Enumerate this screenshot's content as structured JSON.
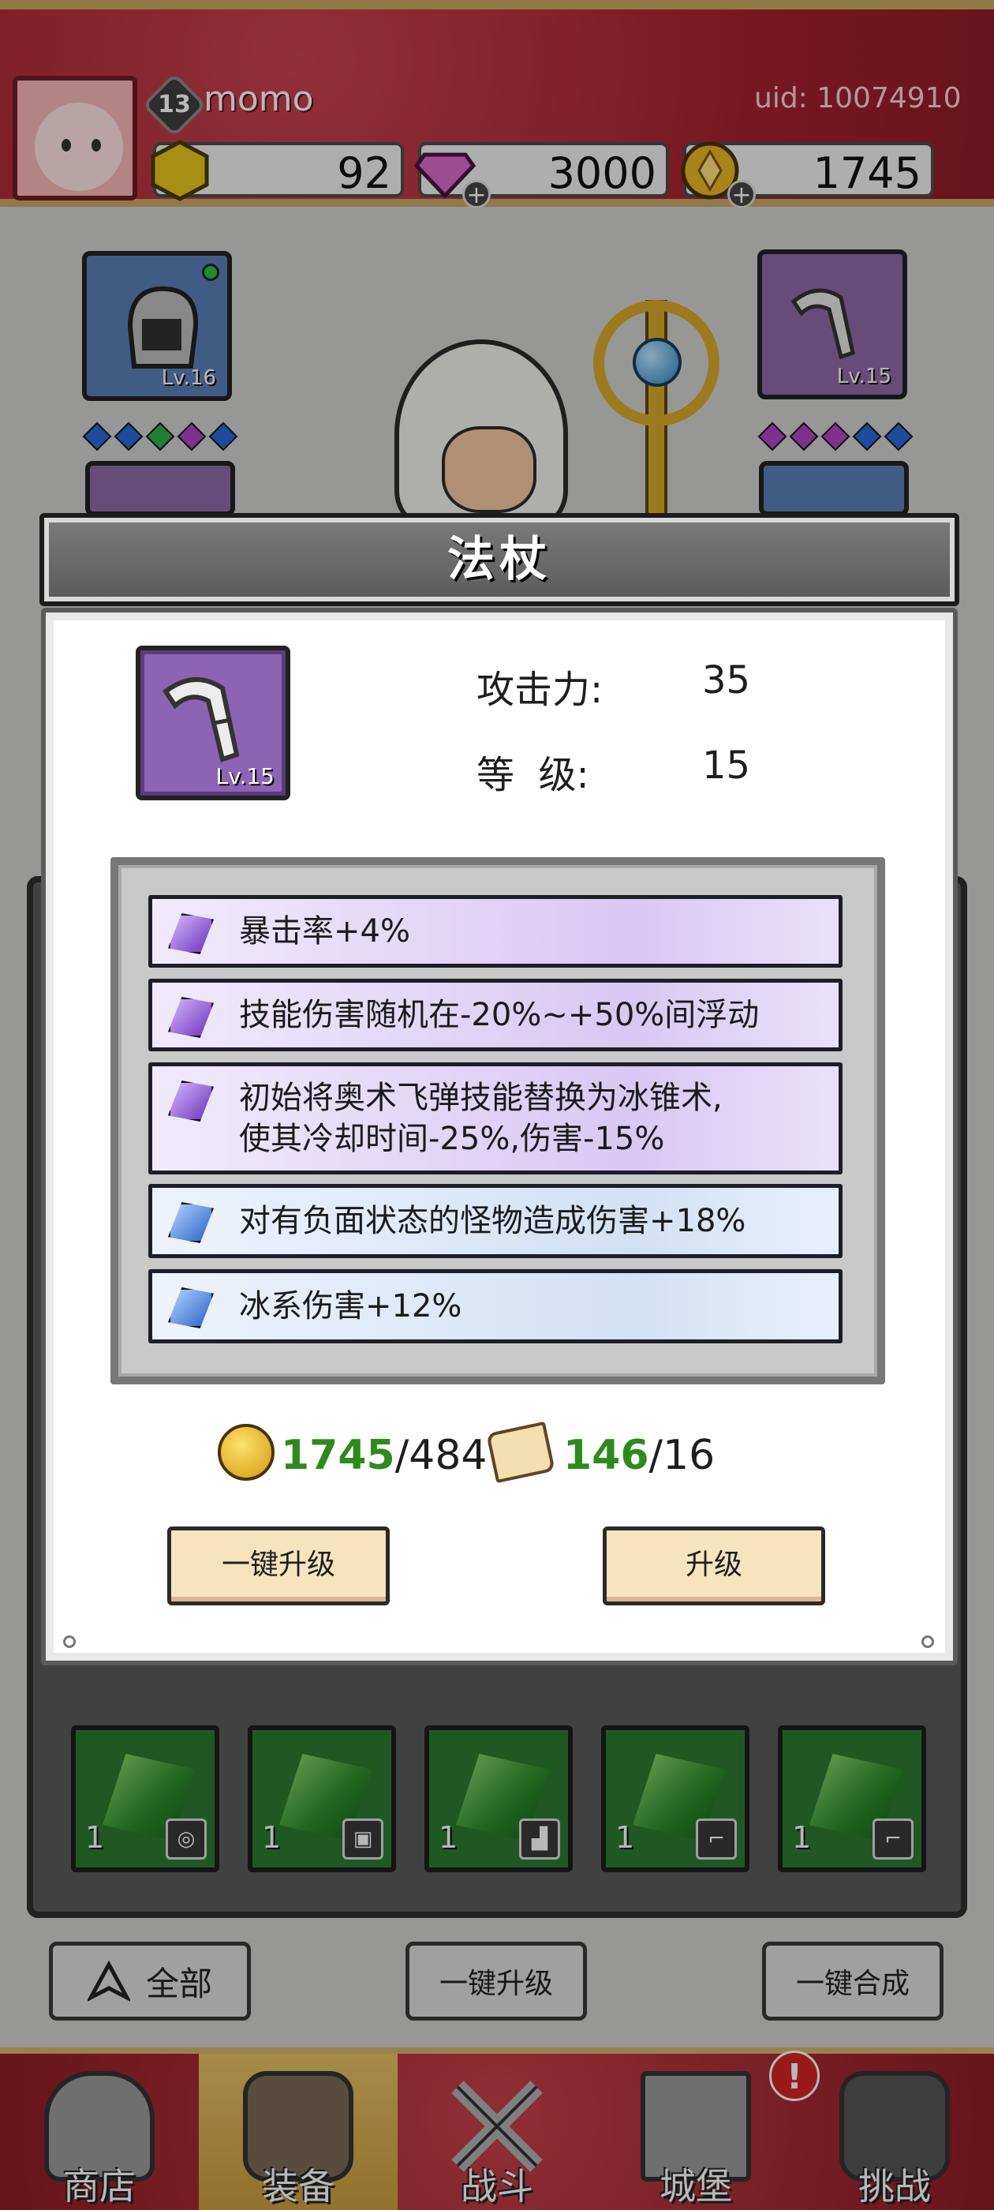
{
  "header": {
    "level": "13",
    "username": "momo",
    "uid": "uid: 10074910",
    "resources": [
      {
        "name": "gold-gem",
        "value": "92"
      },
      {
        "name": "diamond",
        "value": "3000"
      },
      {
        "name": "coin",
        "value": "1745"
      }
    ]
  },
  "equipment": {
    "left_slot": {
      "level_label": "Lv.16"
    },
    "right_slot": {
      "level_label": "Lv.15"
    }
  },
  "inventory": {
    "items": [
      {
        "count": "1",
        "type_icon": "ring-icon"
      },
      {
        "count": "1",
        "type_icon": "armor-icon"
      },
      {
        "count": "1",
        "type_icon": "boot-icon"
      },
      {
        "count": "1",
        "type_icon": "staff-icon"
      },
      {
        "count": "1",
        "type_icon": "staff-icon"
      }
    ]
  },
  "bottom_buttons": {
    "filter": "全部",
    "upgrade_all": "一键升级",
    "merge_all": "一键合成"
  },
  "nav": {
    "items": [
      {
        "label": "商店"
      },
      {
        "label": "装备"
      },
      {
        "label": "战斗"
      },
      {
        "label": "城堡"
      },
      {
        "label": "挑战"
      }
    ],
    "alert": "!"
  },
  "modal": {
    "title": "法杖",
    "item_level_label": "Lv.15",
    "stats": {
      "attack_label": "攻击力:",
      "attack_value": "35",
      "level_label": "等  级:",
      "level_value": "15"
    },
    "affixes": [
      {
        "color": "purple",
        "line1": "暴击率+4%",
        "line2": ""
      },
      {
        "color": "purple",
        "line1": "技能伤害随机在-20%~+50%间浮动",
        "line2": ""
      },
      {
        "color": "purple",
        "line1": "初始将奥术飞弹技能替换为冰锥术,",
        "line2": "使其冷却时间-25%,伤害-15%"
      },
      {
        "color": "blue",
        "line1": "对有负面状态的怪物造成伤害+18%",
        "line2": ""
      },
      {
        "color": "blue",
        "line1": "冰系伤害+12%",
        "line2": ""
      }
    ],
    "cost": {
      "coin_have": "1745",
      "coin_need": "/484",
      "scroll_have": "146",
      "scroll_need": "/16"
    },
    "buttons": {
      "upgrade_all": "一键升级",
      "upgrade": "升级"
    }
  }
}
